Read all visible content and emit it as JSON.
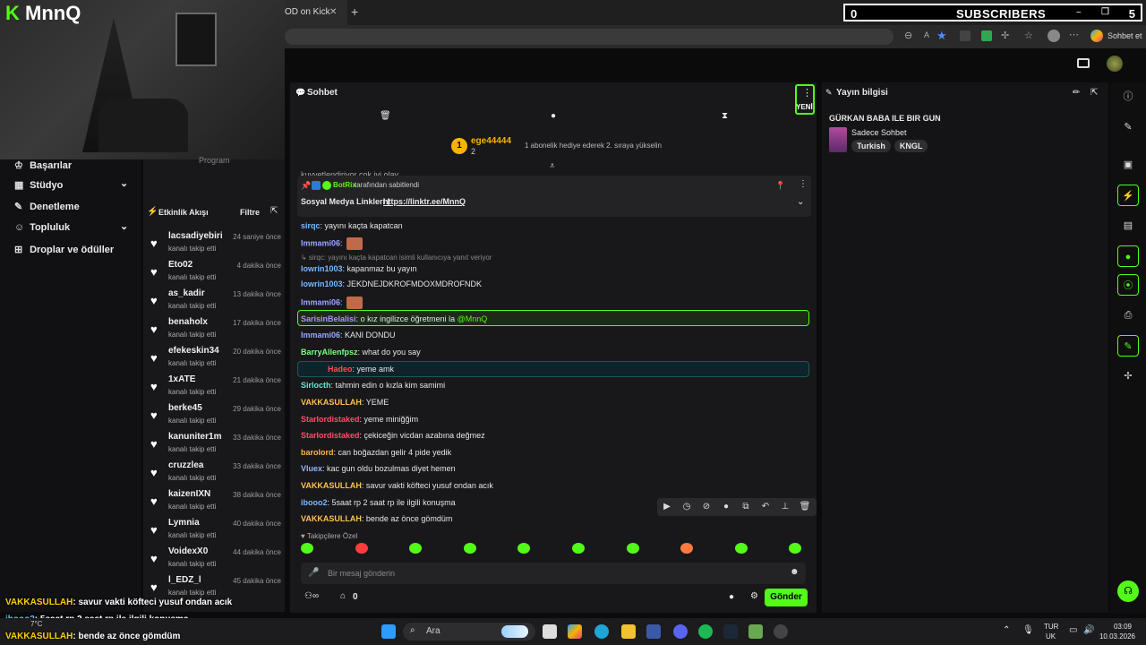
{
  "overlay": {
    "logo_mark": "K",
    "logo_text": "MnnQ",
    "subs_left": "0",
    "subs_label": "SUBSCRIBERS",
    "subs_right": "5",
    "program_label": "Program"
  },
  "browser": {
    "tab_title": "OD on Kick",
    "tab_close": "✕",
    "new_tab": "+",
    "profile_label": "Sohbet et"
  },
  "leftnav": {
    "items": [
      {
        "label": "Başarılar",
        "icon": "trophy-icon"
      },
      {
        "label": "Stüdyo",
        "icon": "grid-icon"
      },
      {
        "label": "Denetleme",
        "icon": "wrench-icon"
      },
      {
        "label": "Topluluk",
        "icon": "people-icon"
      },
      {
        "label": "Droplar ve ödüller",
        "icon": "gift-icon"
      }
    ]
  },
  "feed": {
    "title": "Etkinlik Akışı",
    "filter": "Filtre",
    "rows": [
      {
        "name": "lacsadiyebiri",
        "sub": "kanalı takip etti",
        "time": "24 saniye önce"
      },
      {
        "name": "Eto02",
        "sub": "kanalı takip etti",
        "time": "4 dakika önce"
      },
      {
        "name": "as_kadir",
        "sub": "kanalı takip etti",
        "time": "13 dakika önce"
      },
      {
        "name": "benaholx",
        "sub": "kanalı takip etti",
        "time": "17 dakika önce"
      },
      {
        "name": "efekeskin34",
        "sub": "kanalı takip etti",
        "time": "20 dakika önce"
      },
      {
        "name": "1xATE",
        "sub": "kanalı takip etti",
        "time": "21 dakika önce"
      },
      {
        "name": "berke45",
        "sub": "kanalı takip etti",
        "time": "29 dakika önce"
      },
      {
        "name": "kanuniter1m",
        "sub": "kanalı takip etti",
        "time": "33 dakika önce"
      },
      {
        "name": "cruzzlea",
        "sub": "kanalı takip etti",
        "time": "33 dakika önce"
      },
      {
        "name": "kaizenIXN",
        "sub": "kanalı takip etti",
        "time": "38 dakika önce"
      },
      {
        "name": "Lymnia",
        "sub": "kanalı takip etti",
        "time": "40 dakika önce"
      },
      {
        "name": "VoidexX0",
        "sub": "kanalı takip etti",
        "time": "44 dakika önce"
      },
      {
        "name": "l_EDZ_l",
        "sub": "kanalı takip etti",
        "time": "45 dakika önce"
      }
    ]
  },
  "chat": {
    "title": "Sohbet",
    "new_badge": "YENİ",
    "top_user": "ege44444",
    "top_rank": "1",
    "top_count": "2",
    "top_hint": "1 abonelik hediye ederek 2. sıraya yükselin",
    "cut_line": "kuvvetlendiriyor çok iyi olay",
    "pinned_by": "BotRix",
    "pinned_by_suffix": "tarafından sabitlendi",
    "pinned_text": "Sosyal Medya Linkleri |",
    "pinned_link": "https://linktr.ee/MnnQ",
    "messages": [
      {
        "user": "sirqc",
        "text": "yayını kaçta kapatcan",
        "color": "#7ab8ff"
      },
      {
        "user": "Immami06",
        "text": "",
        "color": "#9aa6ff"
      },
      {
        "user": "",
        "text": "↳ sirqc: yayını kaçta kapatcan isimli kullanıcıya yanıt veriyor",
        "color": "#888"
      },
      {
        "user": "lowrin1003",
        "text": "kapanmaz bu yayın",
        "color": "#7ab8ff"
      },
      {
        "user": "lowrin1003",
        "text": "JEKDNEJDKROFMDOXMDROFNDK",
        "color": "#7ab8ff"
      },
      {
        "user": "Immami06",
        "text": "",
        "color": "#9aa6ff"
      },
      {
        "user": "SarisinBelalisi",
        "text": "o kız ingilizce öğretmeni la",
        "mention": "@MnnQ",
        "color": "#b58cff"
      },
      {
        "user": "Immami06",
        "text": "KANI DONDU",
        "color": "#9aa6ff"
      },
      {
        "user": "BarryAllenfpsz",
        "text": "what do you say",
        "color": "#7dff7d"
      },
      {
        "user": "Hadeo",
        "text": "yeme amk",
        "color": "#ff4d4d"
      },
      {
        "user": "Sirlocth",
        "text": "tahmin edin o kızla kim samimi",
        "color": "#6be4d0"
      },
      {
        "user": "VAKKASULLAH",
        "text": "YEME",
        "color": "#ffc04d"
      },
      {
        "user": "Starlordistaked",
        "text": "yeme miniğğim",
        "color": "#ff4d6a"
      },
      {
        "user": "Starlordistaked",
        "text": "çekiceğin vicdan azabına değmez",
        "color": "#ff4d6a"
      },
      {
        "user": "barolord",
        "text": "can boğazdan gelir 4 pide yedik",
        "color": "#ffb347"
      },
      {
        "user": "Vluex",
        "text": "kac gun oldu bozulmas diyet hemen",
        "color": "#8fb8ff"
      },
      {
        "user": "VAKKASULLAH",
        "text": "savur vakti köfteci yusuf ondan acık",
        "color": "#ffc04d"
      },
      {
        "user": "ibooo2",
        "text": "5saat rp 2 saat rp ile ilgili konuşma",
        "color": "#7ab8ff"
      },
      {
        "user": "VAKKASULLAH",
        "text": "bende az önce gömdüm",
        "color": "#ffc04d"
      }
    ],
    "followers_only": "Takipçilere Özel",
    "input_placeholder": "Bir mesaj gönderin",
    "viewer_count": "0",
    "send_label": "Gönder"
  },
  "info": {
    "title": "Yayın bilgisi",
    "stream_title": "GÜRKAN BABA ILE BIR GUN",
    "category": "Sadece Sohbet",
    "tags": [
      "Turkish",
      "KNGL"
    ]
  },
  "ticker": [
    {
      "user": "VAKKASULLAH",
      "text": ": savur vakti köfteci yusuf ondan acık"
    },
    {
      "user": "ibooo2",
      "text": ": 5saat rp 2 saat rp ile ilgili konuşma"
    },
    {
      "user": "VAKKASULLAH",
      "text": ": bende az önce gömdüm"
    }
  ],
  "taskbar": {
    "search_label": "Ara",
    "lang_top": "TUR",
    "lang_bottom": "UK",
    "time": "03:09",
    "date": "10.03.2026",
    "temp": "7°C"
  }
}
